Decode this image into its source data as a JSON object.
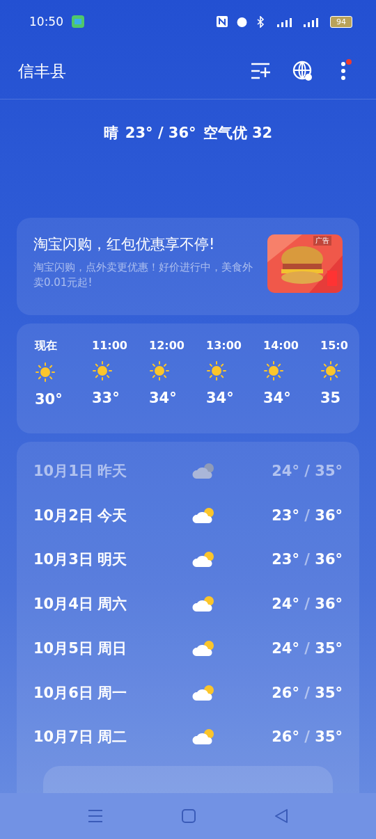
{
  "status_bar": {
    "time": "10:50",
    "battery": "94"
  },
  "header": {
    "city": "信丰县",
    "menu_badge": true
  },
  "summary": {
    "condition": "晴",
    "temps": "23° / 36°",
    "air": "空气优 32"
  },
  "ad": {
    "title": "淘宝闪购，红包优惠享不停!",
    "body": "淘宝闪购，点外卖更优惠！好价进行中，美食外卖0.01元起!",
    "badge": "广告"
  },
  "hourly": [
    {
      "time": "现在",
      "kind": "sunny",
      "temp": "30°"
    },
    {
      "time": "11:00",
      "kind": "sunny",
      "temp": "33°"
    },
    {
      "time": "12:00",
      "kind": "sunny",
      "temp": "34°"
    },
    {
      "time": "13:00",
      "kind": "sunny",
      "temp": "34°"
    },
    {
      "time": "14:00",
      "kind": "sunny",
      "temp": "34°"
    },
    {
      "time": "15:0",
      "kind": "sunny",
      "temp": "35"
    }
  ],
  "daily": [
    {
      "date": "10月1日",
      "day": "昨天",
      "kind": "partly_cloudy",
      "past": true,
      "low": "24°",
      "sep": "/",
      "high": "35°"
    },
    {
      "date": "10月2日",
      "day": "今天",
      "kind": "partly_cloudy",
      "past": false,
      "low": "23°",
      "sep": "/",
      "high": "36°"
    },
    {
      "date": "10月3日",
      "day": "明天",
      "kind": "partly_cloudy",
      "past": false,
      "low": "23°",
      "sep": "/",
      "high": "36°"
    },
    {
      "date": "10月4日",
      "day": "周六",
      "kind": "partly_cloudy",
      "past": false,
      "low": "24°",
      "sep": "/",
      "high": "36°"
    },
    {
      "date": "10月5日",
      "day": "周日",
      "kind": "partly_cloudy",
      "past": false,
      "low": "24°",
      "sep": "/",
      "high": "35°"
    },
    {
      "date": "10月6日",
      "day": "周一",
      "kind": "partly_cloudy",
      "past": false,
      "low": "26°",
      "sep": "/",
      "high": "35°"
    },
    {
      "date": "10月7日",
      "day": "周二",
      "kind": "partly_cloudy",
      "past": false,
      "low": "26°",
      "sep": "/",
      "high": "35°"
    }
  ]
}
